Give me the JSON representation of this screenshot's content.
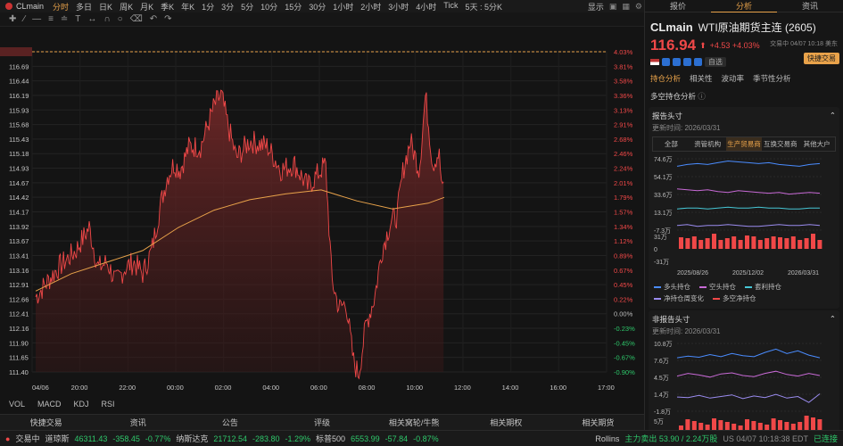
{
  "toolbar": {
    "symbol": "CLmain",
    "periods": [
      "分时",
      "多日",
      "日K",
      "周K",
      "月K",
      "季K",
      "年K",
      "1分",
      "3分",
      "5分",
      "10分",
      "15分",
      "30分",
      "1小时",
      "2小时",
      "3小时",
      "4小时",
      "Tick",
      "5天 : 5分K"
    ],
    "active_period": "分时",
    "display": "显示"
  },
  "price_axis": [
    "116.94",
    "116.69",
    "116.44",
    "116.19",
    "115.93",
    "115.68",
    "115.43",
    "115.18",
    "114.93",
    "114.67",
    "114.42",
    "114.17",
    "113.92",
    "113.67",
    "113.41",
    "113.16",
    "112.91",
    "112.66",
    "112.41",
    "112.16",
    "111.90",
    "111.65",
    "111.40"
  ],
  "pct_axis": [
    "4.03%",
    "3.81%",
    "3.58%",
    "3.36%",
    "3.13%",
    "2.91%",
    "2.68%",
    "2.46%",
    "2.24%",
    "2.01%",
    "1.79%",
    "1.57%",
    "1.34%",
    "1.12%",
    "0.89%",
    "0.67%",
    "0.45%",
    "0.22%",
    "0.00%",
    "-0.23%",
    "-0.45%",
    "-0.67%",
    "-0.90%"
  ],
  "time_axis": [
    "04/06",
    "20:00",
    "22:00",
    "00:00",
    "02:00",
    "04:00",
    "06:00",
    "08:00",
    "10:00",
    "12:00",
    "14:00",
    "16:00",
    "17:00"
  ],
  "indicators": [
    "VOL",
    "MACD",
    "KDJ",
    "RSI"
  ],
  "news_tabs": [
    "快捷交易",
    "资讯",
    "公告",
    "评级",
    "相关窝轮/牛熊",
    "相关期权",
    "相关期货"
  ],
  "status": {
    "session": "交易中",
    "dow_label": "道琼斯",
    "dow_value": "46311.43",
    "dow_chg": "-358.45",
    "dow_pct": "-0.77%",
    "nas_label": "纳斯达克",
    "nas_value": "21712.54",
    "nas_chg": "-283.80",
    "nas_pct": "-1.29%",
    "sp_label": "标普500",
    "sp_value": "6553.99",
    "sp_chg": "-57.84",
    "sp_pct": "-0.87%",
    "flow_label": "Rollins",
    "flow": "主力卖出 53.90 / 2.24万股",
    "time": "US 04/07 10:18:38 EDT",
    "market": "已连接"
  },
  "panel": {
    "tabs": [
      "报价",
      "分析",
      "资讯"
    ],
    "active_tab": "分析",
    "symbol": "CLmain",
    "name": "WTI原油期货主连 (2605)",
    "price": "116.94",
    "change": "+4.53 +4.03%",
    "timestamp": "交易中 04/07 10:18 美东",
    "quick_trade": "快捷交易",
    "tag": "自选",
    "sub_tabs": [
      "持仓分析",
      "相关性",
      "波动率",
      "季节性分析"
    ],
    "active_sub_tab": "持仓分析",
    "section_title": "多空持仓分析",
    "report": {
      "title": "报告头寸",
      "updated": "更新时间: 2026/03/31",
      "segments": [
        "全部",
        "资管机构",
        "生产贸易商",
        "互换交易商",
        "其他大户"
      ],
      "active_segment": "生产贸易商",
      "y_labels": [
        "74.6万",
        "54.1万",
        "33.6万",
        "13.1万",
        "-7.3万"
      ],
      "bar_labels": [
        "31万",
        "0",
        "-31万"
      ],
      "x_labels": [
        "2025/08/26",
        "2025/12/02",
        "2026/03/31"
      ],
      "legend": [
        "多头持仓",
        "空头持仓",
        "套利持仓",
        "净持仓周变化",
        "多空净持仓"
      ]
    },
    "nonreport": {
      "title": "非报告头寸",
      "updated": "更新时间: 2026/03/31",
      "y_labels": [
        "10.8万",
        "7.6万",
        "4.5万",
        "1.4万",
        "-1.8万"
      ],
      "bar_labels": [
        "5万"
      ]
    }
  },
  "colors": {
    "up": "#f04848",
    "down": "#2ec86b",
    "accent": "#e8a24a",
    "avg": "#e8a24a"
  }
}
